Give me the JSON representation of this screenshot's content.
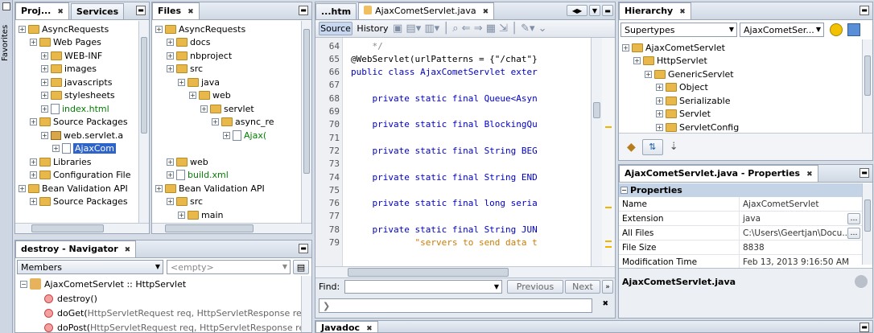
{
  "sidebar": {
    "favorites": "Favorites"
  },
  "projects": {
    "tabs": [
      "Proj...",
      "Services"
    ],
    "tree": [
      {
        "label": "AsyncRequests",
        "lvl": 0
      },
      {
        "label": "Web Pages",
        "lvl": 1
      },
      {
        "label": "WEB-INF",
        "lvl": 2
      },
      {
        "label": "images",
        "lvl": 2
      },
      {
        "label": "javascripts",
        "lvl": 2
      },
      {
        "label": "stylesheets",
        "lvl": 2
      },
      {
        "label": "index.html",
        "lvl": 2
      },
      {
        "label": "Source Packages",
        "lvl": 1
      },
      {
        "label": "web.servlet.a",
        "lvl": 2
      },
      {
        "label": "AjaxCom",
        "lvl": 3
      },
      {
        "label": "Libraries",
        "lvl": 1
      },
      {
        "label": "Configuration File",
        "lvl": 1
      },
      {
        "label": "Bean Validation API",
        "lvl": 0
      },
      {
        "label": "Source Packages",
        "lvl": 1
      }
    ]
  },
  "files": {
    "tab": "Files",
    "tree": [
      {
        "label": "AsyncRequests",
        "lvl": 0
      },
      {
        "label": "docs",
        "lvl": 1
      },
      {
        "label": "nbproject",
        "lvl": 1
      },
      {
        "label": "src",
        "lvl": 1
      },
      {
        "label": "java",
        "lvl": 2
      },
      {
        "label": "web",
        "lvl": 3
      },
      {
        "label": "servlet",
        "lvl": 4
      },
      {
        "label": "async_re",
        "lvl": 5
      },
      {
        "label": "Ajax(",
        "lvl": 6
      },
      {
        "label": "",
        "lvl": 0
      },
      {
        "label": "web",
        "lvl": 1
      },
      {
        "label": "build.xml",
        "lvl": 1
      },
      {
        "label": "Bean Validation API",
        "lvl": 0
      },
      {
        "label": "src",
        "lvl": 1
      },
      {
        "label": "main",
        "lvl": 2
      }
    ]
  },
  "editor": {
    "tabs": [
      "...htm",
      "AjaxCometServlet.java"
    ],
    "source": "Source",
    "history": "History",
    "lines": [
      {
        "n": "64",
        "t": "    */"
      },
      {
        "n": "65",
        "t": "@WebServlet(urlPatterns = {\"/chat\"}"
      },
      {
        "n": "66",
        "t": "public class AjaxCometServlet exter"
      },
      {
        "n": "67",
        "t": ""
      },
      {
        "n": "68",
        "t": "    private static final Queue<Asyn"
      },
      {
        "n": "69",
        "t": ""
      },
      {
        "n": "70",
        "t": "    private static final BlockingQu"
      },
      {
        "n": "71",
        "t": ""
      },
      {
        "n": "72",
        "t": "    private static final String BEG"
      },
      {
        "n": "73",
        "t": ""
      },
      {
        "n": "74",
        "t": "    private static final String END"
      },
      {
        "n": "75",
        "t": ""
      },
      {
        "n": "76",
        "t": "    private static final long seria"
      },
      {
        "n": "77",
        "t": ""
      },
      {
        "n": "78",
        "t": "    private static final String JUN"
      },
      {
        "n": "79",
        "t": "            \"servers to send data t"
      }
    ],
    "find_label": "Find:",
    "previous": "Previous",
    "next": "Next"
  },
  "hierarchy": {
    "tab": "Hierarchy",
    "mode": "Supertypes",
    "class_combo": "AjaxCometSer...",
    "tree": [
      {
        "label": "AjaxCometServlet",
        "lvl": 0
      },
      {
        "label": "HttpServlet",
        "lvl": 1
      },
      {
        "label": "GenericServlet",
        "lvl": 2
      },
      {
        "label": "Object",
        "lvl": 3
      },
      {
        "label": "Serializable",
        "lvl": 3
      },
      {
        "label": "Servlet",
        "lvl": 3
      },
      {
        "label": "ServletConfig",
        "lvl": 3
      }
    ]
  },
  "properties": {
    "tab": "AjaxCometServlet.java - Properties",
    "section": "Properties",
    "rows": [
      {
        "k": "Name",
        "v": "AjaxCometServlet"
      },
      {
        "k": "Extension",
        "v": "java"
      },
      {
        "k": "All Files",
        "v": "C:\\Users\\Geertjan\\Docu..."
      },
      {
        "k": "File Size",
        "v": "8838"
      },
      {
        "k": "Modification Time",
        "v": "Feb 13, 2013 9:16:50 AM"
      }
    ],
    "footer": "AjaxCometServlet.java"
  },
  "navigator": {
    "tab": "destroy - Navigator",
    "members": "Members",
    "filter": "<empty>",
    "root": "AjaxCometServlet :: HttpServlet",
    "items": [
      {
        "name": "destroy()",
        "params": ""
      },
      {
        "name": "doGet(",
        "params": "HttpServletRequest req, HttpServletResponse res)"
      },
      {
        "name": "doPost(",
        "params": "HttpServletRequest req, HttpServletResponse res)"
      }
    ]
  },
  "javadoc": {
    "tab": "Javadoc"
  }
}
